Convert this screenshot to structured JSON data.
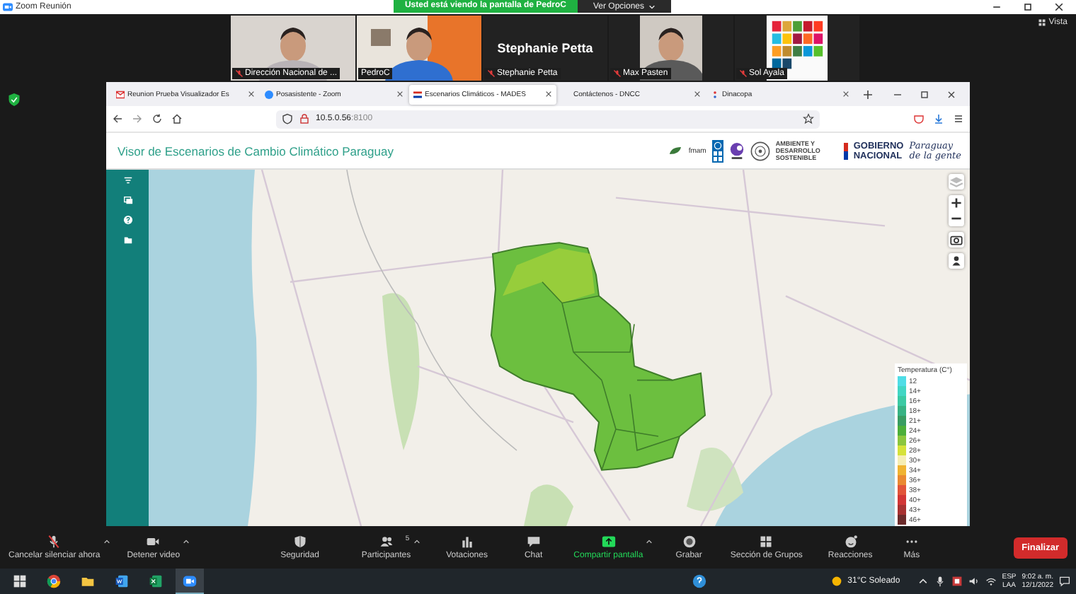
{
  "window": {
    "title": "Zoom Reunión"
  },
  "banner": {
    "text": "Usted está viendo la pantalla de PedroC",
    "options": "Ver Opciones"
  },
  "view_button": "Vista",
  "participants": [
    {
      "name": "Dirección Nacional de ...",
      "kind": "video",
      "muted": true
    },
    {
      "name": "PedroC",
      "kind": "video",
      "muted": false
    },
    {
      "name": "Stephanie Petta",
      "kind": "name_only",
      "big_name": "Stephanie Petta",
      "muted": true
    },
    {
      "name": "Max Pasten",
      "kind": "video",
      "muted": true
    },
    {
      "name": "Sol Ayala",
      "muted": true
    }
  ],
  "browser": {
    "tabs": [
      {
        "label": "Reunion Prueba Visualizador Es",
        "kind": "mail",
        "selected": false
      },
      {
        "label": "Posasistente - Zoom",
        "kind": "zoom",
        "selected": false
      },
      {
        "label": "Escenarios Climáticos - MADES",
        "kind": "flag",
        "selected": true
      },
      {
        "label": "Contáctenos - DNCC",
        "kind": "blank",
        "selected": false
      },
      {
        "label": "Dinacopa",
        "kind": "dots",
        "selected": false
      }
    ],
    "url": "10.5.0.56",
    "port": ":8100"
  },
  "app": {
    "title": "Visor de Escenarios de Cambio Climático Paraguay",
    "logos": {
      "fmam": "fmam",
      "ministry": "AMBIENTE Y DESARROLLO SOSTENIBLE",
      "gov_line1": "GOBIERNO",
      "gov_line2": "NACIONAL",
      "slogan_line1": "Paraguay",
      "slogan_line2": "de la gente"
    },
    "legend": {
      "title": "Temperatura (C°)",
      "items": [
        {
          "label": "12",
          "color": "#4fdde6"
        },
        {
          "label": "14+",
          "color": "#42d6c4"
        },
        {
          "label": "16+",
          "color": "#3ccaa4"
        },
        {
          "label": "18+",
          "color": "#38b384"
        },
        {
          "label": "21+",
          "color": "#399d62"
        },
        {
          "label": "24+",
          "color": "#4caf3a"
        },
        {
          "label": "26+",
          "color": "#8cc63e"
        },
        {
          "label": "28+",
          "color": "#d6e23a"
        },
        {
          "label": "30+",
          "color": "#f6eeb4"
        },
        {
          "label": "34+",
          "color": "#f0b432"
        },
        {
          "label": "36+",
          "color": "#ea8a32"
        },
        {
          "label": "38+",
          "color": "#e2553a"
        },
        {
          "label": "40+",
          "color": "#d23636"
        },
        {
          "label": "43+",
          "color": "#a83232"
        },
        {
          "label": "46+",
          "color": "#6c2c2c"
        }
      ]
    }
  },
  "toolbar": {
    "items": [
      {
        "label": "Cancelar silenciar ahora",
        "kind": "mic_muted",
        "menu": true,
        "active": false
      },
      {
        "label": "Detener video",
        "kind": "video",
        "menu": true,
        "active": false
      },
      {
        "label": "Seguridad",
        "kind": "shield",
        "menu": false,
        "active": false
      },
      {
        "label": "Participantes",
        "kind": "people",
        "count": "5",
        "menu": true,
        "active": false
      },
      {
        "label": "Votaciones",
        "kind": "poll",
        "menu": false,
        "active": false
      },
      {
        "label": "Chat",
        "kind": "chat",
        "menu": false,
        "active": false
      },
      {
        "label": "Compartir pantalla",
        "kind": "share",
        "menu": true,
        "active": true
      },
      {
        "label": "Grabar",
        "kind": "record",
        "menu": false,
        "active": false
      },
      {
        "label": "Sección de Grupos",
        "kind": "grid",
        "menu": false,
        "active": false
      },
      {
        "label": "Reacciones",
        "kind": "reaction",
        "menu": false,
        "active": false
      },
      {
        "label": "Más",
        "kind": "more",
        "menu": false,
        "active": false
      }
    ],
    "end": "Finalizar"
  },
  "taskbar": {
    "apps": [
      {
        "kind": "start",
        "selected": false
      },
      {
        "kind": "chrome",
        "selected": false
      },
      {
        "kind": "folder",
        "selected": false
      },
      {
        "kind": "word",
        "selected": false
      },
      {
        "kind": "excel",
        "selected": false
      },
      {
        "kind": "zoom",
        "selected": true
      }
    ],
    "weather": "31°C Soleado",
    "lang1": "ESP",
    "lang2": "LAA",
    "time": "9:02 a. m.",
    "date": "12/1/2022"
  }
}
